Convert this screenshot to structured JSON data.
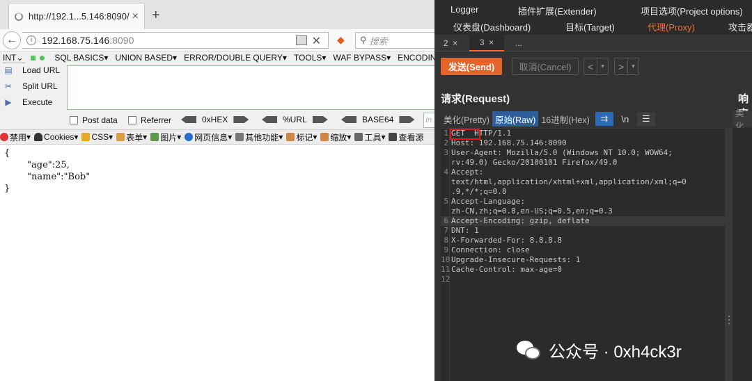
{
  "browser": {
    "tab_title": "http://192.1...5.146:8090/",
    "url_host": "192.168.75.146",
    "url_port": ":8090",
    "search_placeholder": "搜索"
  },
  "hackbar": {
    "select_value": "INT",
    "menus": [
      "SQL BASICS",
      "UNION BASED",
      "ERROR/DOUBLE QUERY",
      "TOOLS",
      "WAF BYPASS",
      "ENCODIN"
    ],
    "actions": [
      "Load URL",
      "Split URL",
      "Execute"
    ],
    "checkboxes": [
      "Post data",
      "Referrer"
    ],
    "encoders": [
      "0xHEX",
      "%URL",
      "BASE64"
    ],
    "input_placeholder": "In"
  },
  "webdev_toolbar": [
    "禁用",
    "Cookies",
    "CSS",
    "表单",
    "图片",
    "网页信息",
    "其他功能",
    "标记",
    "缩放",
    "工具",
    "查看源"
  ],
  "page_content": "{\n        \"age\":25,\n        \"name\":\"Bob\"\n}",
  "burp": {
    "top_tabs_row1": [
      "Logger",
      "插件扩展(Extender)",
      "项目选项(Project options)"
    ],
    "top_tabs_row2": [
      "仪表盘(Dashboard)",
      "目标(Target)",
      "代理(Proxy)",
      "攻击器"
    ],
    "active_tab": "代理(Proxy)",
    "subtabs": [
      "2",
      "3",
      "..."
    ],
    "send_label": "发送(Send)",
    "cancel_label": "取消(Cancel)",
    "request_title": "请求(Request)",
    "response_title": "响应",
    "view_tabs": [
      "美化(Pretty)",
      "原始(Raw)",
      "16进制(Hex)"
    ],
    "active_view": "原始(Raw)",
    "response_view_tab": "美化",
    "request_lines": [
      {
        "n": "1",
        "text": "GET  HTTP/1.1"
      },
      {
        "n": "2",
        "text": "Host: 192.168.75.146:8090"
      },
      {
        "n": "3",
        "text": "User-Agent: Mozilla/5.0 (Windows NT 10.0; WOW64;"
      },
      {
        "n": "",
        "text": "rv:49.0) Gecko/20100101 Firefox/49.0"
      },
      {
        "n": "4",
        "text": "Accept:"
      },
      {
        "n": "",
        "text": "text/html,application/xhtml+xml,application/xml;q=0"
      },
      {
        "n": "",
        "text": ".9,*/*;q=0.8"
      },
      {
        "n": "5",
        "text": "Accept-Language:"
      },
      {
        "n": "",
        "text": "zh-CN,zh;q=0.8,en-US;q=0.5,en;q=0.3"
      },
      {
        "n": "6",
        "text": "Accept-Encoding: gzip, deflate"
      },
      {
        "n": "7",
        "text": "DNT: 1"
      },
      {
        "n": "8",
        "text": "X-Forwarded-For: 8.8.8.8"
      },
      {
        "n": "9",
        "text": "Connection: close"
      },
      {
        "n": "10",
        "text": "Upgrade-Insecure-Requests: 1"
      },
      {
        "n": "11",
        "text": "Cache-Control: max-age=0"
      },
      {
        "n": "12",
        "text": ""
      }
    ]
  },
  "watermark": "公众号 · 0xh4ck3r",
  "colors": {
    "burp_accent": "#ef6e2e",
    "send_button": "#e5642a",
    "highlight_box": "#e0191b",
    "raw_tab": "#2e5e9a"
  }
}
